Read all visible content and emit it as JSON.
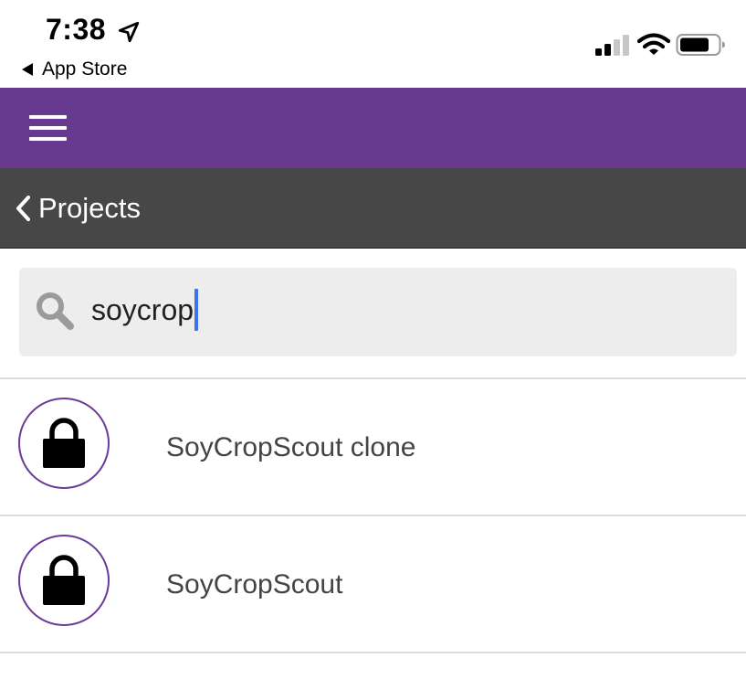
{
  "status_bar": {
    "time": "7:38",
    "back_app": "App Store",
    "icons": [
      "location-arrow-icon",
      "cellular-signal-icon",
      "wifi-icon",
      "battery-icon"
    ]
  },
  "header": {
    "menu_icon": "hamburger-menu-icon",
    "accent_color": "#673a8f"
  },
  "nav": {
    "back_label": "Projects",
    "back_icon": "chevron-left-icon",
    "background_color": "#474747"
  },
  "search": {
    "value": "soycrop",
    "icon": "search-icon"
  },
  "projects": [
    {
      "name": "SoyCropScout clone",
      "icon": "lock-icon"
    },
    {
      "name": "SoyCropScout",
      "icon": "lock-icon"
    }
  ]
}
